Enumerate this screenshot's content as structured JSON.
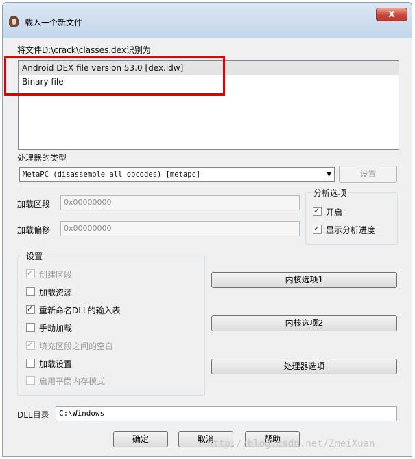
{
  "window": {
    "title": "载入一个新文件",
    "close_label": "X"
  },
  "file_prompt": "将文件D:\\crack\\classes.dex识别为",
  "file_types": [
    {
      "label": "Android DEX file version 53.0 [dex.ldw]",
      "selected": true
    },
    {
      "label": "Binary file",
      "selected": false
    }
  ],
  "processor": {
    "label": "处理器的类型",
    "selected": "MetaPC (disassemble all opcodes) [metapc]",
    "set_button": "设置"
  },
  "loading": {
    "segment_label": "加载区段",
    "segment_value": "0x00000000",
    "offset_label": "加载偏移",
    "offset_value": "0x00000000"
  },
  "analysis": {
    "title": "分析选项",
    "options": [
      {
        "label": "开启",
        "checked": true
      },
      {
        "label": "显示分析进度",
        "checked": true
      }
    ]
  },
  "settings": {
    "title": "设置",
    "options": [
      {
        "label": "创建区段",
        "checked": true,
        "enabled": false
      },
      {
        "label": "加载资源",
        "checked": false,
        "enabled": true
      },
      {
        "label": "重新命名DLL的输入表",
        "checked": true,
        "enabled": true
      },
      {
        "label": "手动加载",
        "checked": false,
        "enabled": true
      },
      {
        "label": "填充区段之间的空白",
        "checked": true,
        "enabled": false
      },
      {
        "label": "加载设置",
        "checked": false,
        "enabled": true
      },
      {
        "label": "启用平面内存模式",
        "checked": false,
        "enabled": false
      }
    ]
  },
  "option_buttons": {
    "kernel1": "内核选项1",
    "kernel2": "内核选项2",
    "processor": "处理器选项"
  },
  "dll": {
    "label": "DLL目录",
    "value": "C:\\Windows"
  },
  "footer": {
    "ok": "确定",
    "cancel": "取消",
    "help": "帮助"
  },
  "watermark": "http://blog.csdn.net/ZmeiXuan"
}
